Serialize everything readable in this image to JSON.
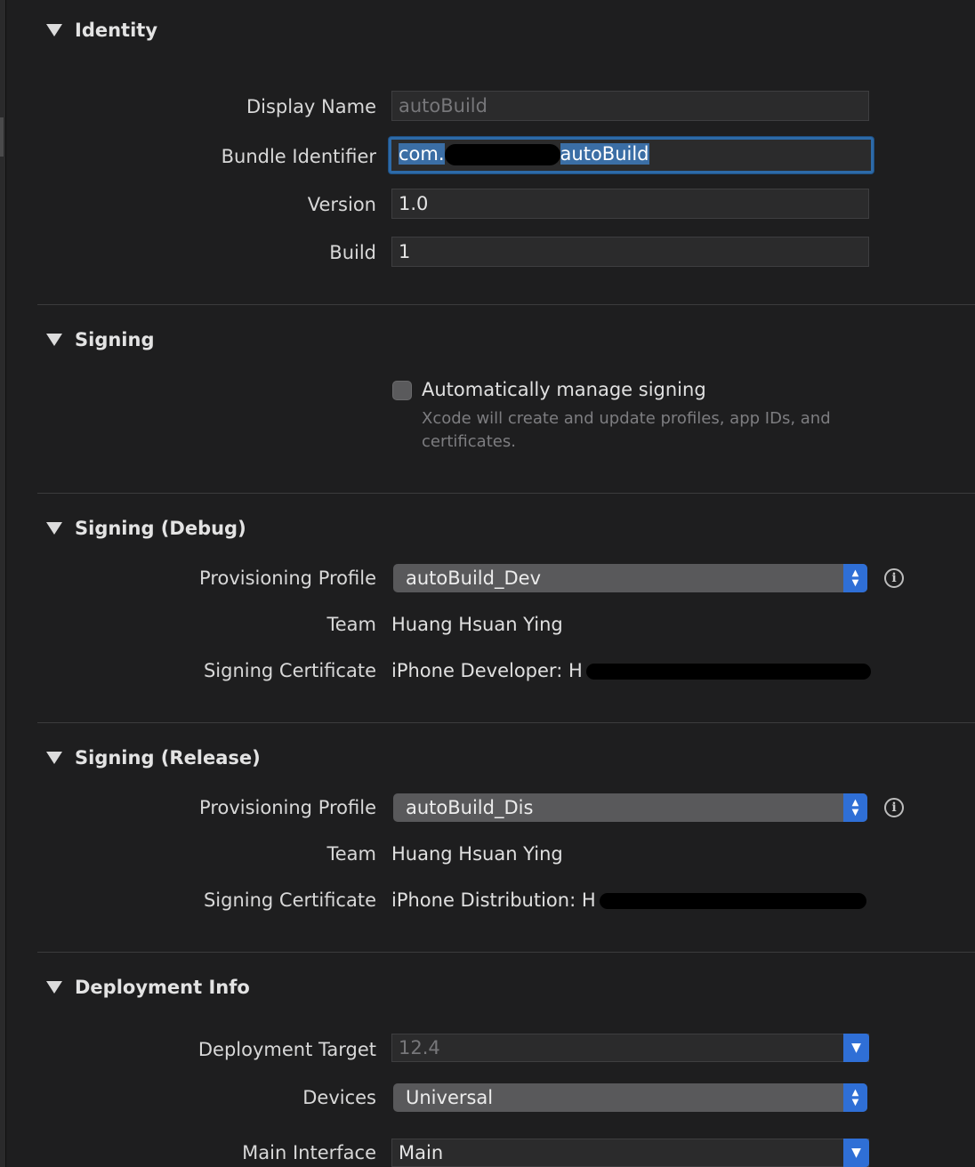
{
  "identity": {
    "title": "Identity",
    "display_name_label": "Display Name",
    "display_name_value": "autoBuild",
    "bundle_id_label": "Bundle Identifier",
    "bundle_id_prefix": "com.",
    "bundle_id_suffix": "autoBuild",
    "version_label": "Version",
    "version_value": "1.0",
    "build_label": "Build",
    "build_value": "1"
  },
  "signing": {
    "title": "Signing",
    "auto_manage_label": "Automatically manage signing",
    "auto_manage_checked": false,
    "auto_manage_help": "Xcode will create and update profiles, app IDs, and certificates."
  },
  "signing_debug": {
    "title": "Signing (Debug)",
    "profile_label": "Provisioning Profile",
    "profile_value": "autoBuild_Dev",
    "team_label": "Team",
    "team_value": "Huang Hsuan Ying",
    "cert_label": "Signing Certificate",
    "cert_value": "iPhone Developer: H"
  },
  "signing_release": {
    "title": "Signing (Release)",
    "profile_label": "Provisioning Profile",
    "profile_value": "autoBuild_Dis",
    "team_label": "Team",
    "team_value": "Huang Hsuan Ying",
    "cert_label": "Signing Certificate",
    "cert_value": "iPhone Distribution: H"
  },
  "deployment": {
    "title": "Deployment Info",
    "target_label": "Deployment Target",
    "target_value": "12.4",
    "devices_label": "Devices",
    "devices_value": "Universal",
    "main_interface_label": "Main Interface",
    "main_interface_value": "Main"
  },
  "icons": {
    "disclosure": "disclosure-triangle-icon",
    "info": "info-circle-icon",
    "stepper": "up-down-chevron-icon",
    "dropdown": "chevron-down-icon"
  },
  "colors": {
    "background": "#1e1e1f",
    "accent": "#2f6fd6",
    "focus_ring": "#2d6aa8"
  }
}
